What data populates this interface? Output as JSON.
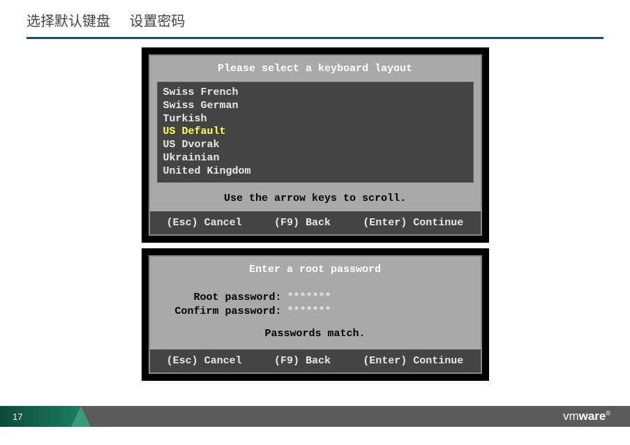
{
  "slide": {
    "title_part1": "选择默认键盘",
    "title_part2": "设置密码",
    "page_number": "17"
  },
  "keyboard_dialog": {
    "title": "Please select a keyboard layout",
    "items": {
      "0": "Swiss French",
      "1": "Swiss German",
      "2": "Turkish",
      "3": "US Default",
      "4": "US Dvorak",
      "5": "Ukrainian",
      "6": "United Kingdom"
    },
    "hint": "Use the arrow keys to scroll.",
    "cancel": "(Esc) Cancel",
    "back": "(F9) Back",
    "continue": "(Enter) Continue"
  },
  "password_dialog": {
    "title": "Enter a root password",
    "root_label": "Root password:",
    "root_value": "*******",
    "confirm_label": "Confirm password:",
    "confirm_value": "*******",
    "match_text": "Passwords match.",
    "cancel": "(Esc) Cancel",
    "back": "(F9) Back",
    "continue": "(Enter) Continue"
  },
  "footer": {
    "brand_thin": "vm",
    "brand_bold": "ware",
    "brand_tm": "®"
  }
}
